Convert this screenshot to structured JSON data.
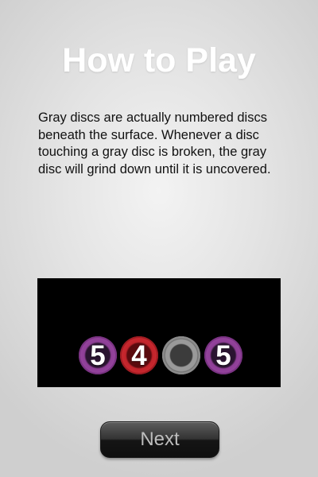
{
  "screen": {
    "title": "How to Play",
    "description": "Gray discs are actually numbered discs beneath the surface. Whenever a disc touching a gray disc is broken, the gray disc will grind down until it is uncovered.",
    "next_label": "Next"
  },
  "demo": {
    "discs": [
      {
        "label": "5",
        "color": "#a24cab"
      },
      {
        "label": "4",
        "color": "#d83038"
      },
      {
        "label": "",
        "color": "#9a9a9a"
      },
      {
        "label": "5",
        "color": "#a24cab"
      }
    ]
  }
}
